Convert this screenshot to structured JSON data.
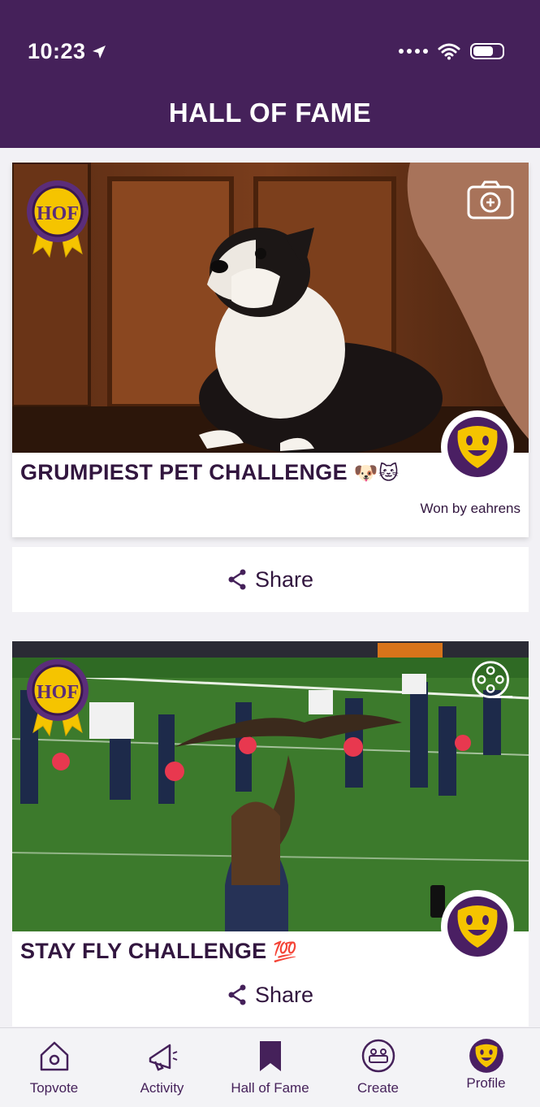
{
  "status_bar": {
    "time": "10:23"
  },
  "header": {
    "title": "HALL OF FAME"
  },
  "cards": [
    {
      "title": "GRUMPIEST PET CHALLENGE",
      "emojis": "🐶🐱",
      "won_by": "Won by eahrens",
      "badge_text": "HOF",
      "media_type": "camera-icon"
    },
    {
      "title": "STAY FLY CHALLENGE",
      "emojis": "💯",
      "badge_text": "HOF",
      "media_type": "film-reel-icon"
    }
  ],
  "share": {
    "label": "Share"
  },
  "nav": {
    "items": [
      {
        "label": "Topvote",
        "icon": "house-icon"
      },
      {
        "label": "Activity",
        "icon": "megaphone-icon"
      },
      {
        "label": "Hall of Fame",
        "icon": "bookmark-icon"
      },
      {
        "label": "Create",
        "icon": "create-icon"
      },
      {
        "label": "Profile",
        "icon": "profile-avatar-icon"
      }
    ]
  },
  "colors": {
    "brand_purple": "#45215a",
    "accent_yellow": "#f5c400",
    "title_text": "#32163f"
  }
}
